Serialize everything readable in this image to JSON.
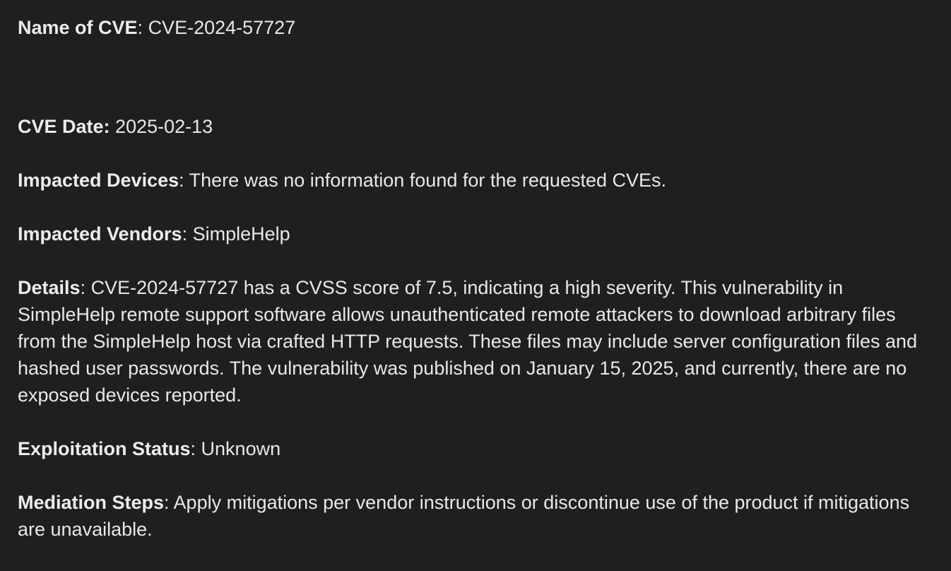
{
  "cve": {
    "name_label": "Name of CVE",
    "name_sep": ": ",
    "name_value": "CVE-2024-57727",
    "date_label": "CVE Date:",
    "date_sep": " ",
    "date_value": "2025-02-13",
    "devices_label": "Impacted Devices",
    "devices_sep": ": ",
    "devices_value": "There was no information found for the requested CVEs.",
    "vendors_label": "Impacted Vendors",
    "vendors_sep": ": ",
    "vendors_value": "SimpleHelp",
    "details_label": "Details",
    "details_sep": ": ",
    "details_value": "CVE-2024-57727 has a CVSS score of 7.5, indicating a high severity. This vulnerability in SimpleHelp remote support software allows unauthenticated remote attackers to download arbitrary files from the SimpleHelp host via crafted HTTP requests. These files may include server configuration files and hashed user passwords. The vulnerability was published on January 15, 2025, and currently, there are no exposed devices reported.",
    "exploitation_label": "Exploitation Status",
    "exploitation_sep": ": ",
    "exploitation_value": "Unknown",
    "mediation_label": "Mediation Steps",
    "mediation_sep": ": ",
    "mediation_value": "Apply mitigations per vendor instructions or discontinue use of the product if mitigations are unavailable."
  }
}
